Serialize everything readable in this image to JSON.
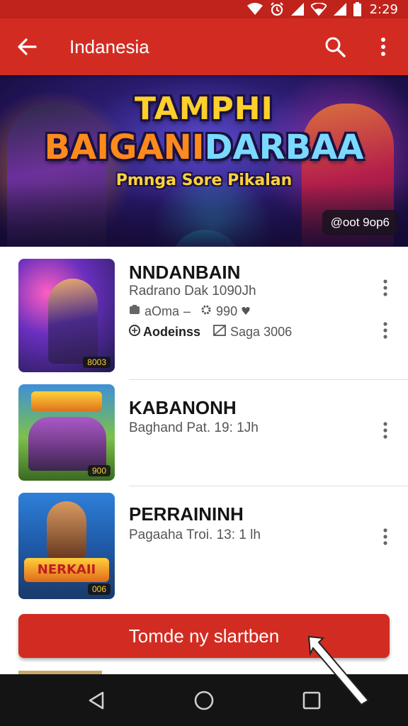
{
  "status_bar": {
    "time": "2:29",
    "icons": [
      "wifi-icon",
      "alarm-icon",
      "signal-icon",
      "wifi-icon",
      "signal-icon",
      "battery-icon"
    ]
  },
  "app_bar": {
    "title": "Indanesia",
    "icons": [
      "back-arrow-icon",
      "search-icon",
      "more-vert-icon"
    ],
    "color": "#d22c22"
  },
  "banner": {
    "title_line1": "TAMPHI",
    "title_line2_a": "BAIGANI",
    "title_line2_b": "DARBAA",
    "subtitle": "Pmnga Sore Pikalan",
    "badge": "@oot 9op6"
  },
  "list": {
    "items": [
      {
        "name": "NNDANBAIN",
        "meta": "Radrano Dak 1090Jh",
        "stats_left": "aOma",
        "stats_sep": "–",
        "stats_right": "990",
        "developer": "Aodeinss",
        "downloads": "Saga 3006",
        "thumb_tag": "8003"
      },
      {
        "name": "KABANONH",
        "meta": "Baghand Pat. 19: 1Jh",
        "thumb_tag": "900"
      },
      {
        "name": "PERRAININH",
        "meta": "Pagaaha Troi. 13: 1 lh",
        "thumb_tag": "006",
        "thumb_text": "NERKAII"
      }
    ]
  },
  "cta": {
    "label": "Tomde ny slartben"
  },
  "nav_bar": {
    "icons": [
      "back-triangle-icon",
      "home-circle-icon",
      "recents-square-icon"
    ]
  }
}
